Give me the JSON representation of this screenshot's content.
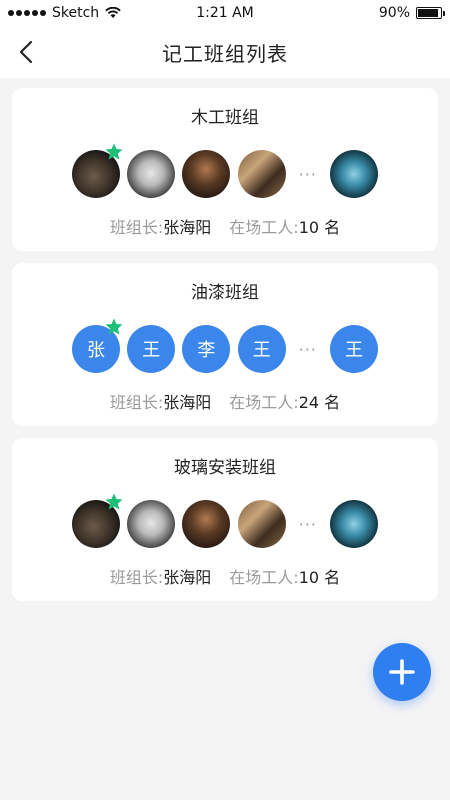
{
  "status_bar": {
    "carrier": "Sketch",
    "time": "1:21 AM",
    "battery": "90%"
  },
  "nav": {
    "title": "记工班组列表",
    "back_icon": "chevron-left-icon"
  },
  "labels": {
    "leader_label": "班组长:",
    "workers_label": "在场工人:",
    "ellipsis": "···"
  },
  "colors": {
    "accent": "#3b86ea",
    "fab": "#2f7ff0",
    "star": "#1fbf7a",
    "background": "#f4f4f5"
  },
  "groups": [
    {
      "name": "木工班组",
      "members": [
        "cat-photo",
        "woman-photo",
        "hat-photo",
        "room-photo"
      ],
      "last_member": "blue-photo",
      "leader": "张海阳",
      "workers": "10 名"
    },
    {
      "name": "油漆班组",
      "members": [
        "张",
        "王",
        "李",
        "王"
      ],
      "last_member": "王",
      "leader": "张海阳",
      "workers": "24 名"
    },
    {
      "name": "玻璃安装班组",
      "members": [
        "cat-photo",
        "woman-photo",
        "hat-photo",
        "room-photo"
      ],
      "last_member": "blue-photo",
      "leader": "张海阳",
      "workers": "10 名"
    }
  ],
  "fab": {
    "icon": "plus-icon"
  }
}
